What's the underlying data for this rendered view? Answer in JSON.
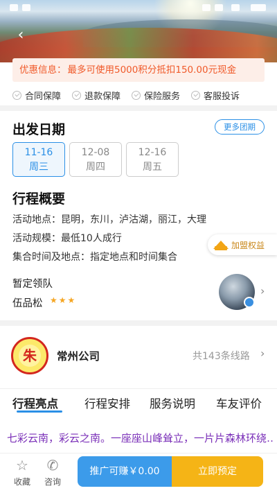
{
  "promo": {
    "label": "优惠信息：",
    "text": "最多可使用5000积分抵扣150.00元现金"
  },
  "guarantees": [
    "合同保障",
    "退款保障",
    "保险服务",
    "客服投诉"
  ],
  "departure": {
    "title": "出发日期",
    "more_button": "更多团期",
    "dates": [
      {
        "date": "11-16",
        "weekday": "周三",
        "selected": true
      },
      {
        "date": "12-08",
        "weekday": "周四",
        "selected": false
      },
      {
        "date": "12-16",
        "weekday": "周五",
        "selected": false
      }
    ]
  },
  "overview": {
    "title": "行程概要",
    "lines": [
      "活动地点：昆明，东川，泸沽湖，丽江，大理",
      "活动规模：最低10人成行",
      "集合时间及地点：指定地点和时间集合"
    ]
  },
  "join_benefits": "加盟权益",
  "leader": {
    "title": "暂定领队",
    "name": "伍品松",
    "stars": "★★★"
  },
  "company": {
    "logo_char": "朱",
    "name": "常州公司",
    "routes": "共143条线路"
  },
  "tabs": [
    "行程亮点",
    "行程安排",
    "服务说明",
    "车友评价"
  ],
  "highlight_text": "七彩云南，彩云之南。一座座山峰耸立，一片片森林环绕……",
  "bottom_bar": {
    "favorite": "收藏",
    "consult": "咨询",
    "earn_button": "推广可赚￥0.00",
    "book_button": "立即预定"
  },
  "colors": {
    "accent": "#2a8fe6",
    "promo": "#f05a2a",
    "book": "#f5b416",
    "earn": "#3c9bea"
  }
}
